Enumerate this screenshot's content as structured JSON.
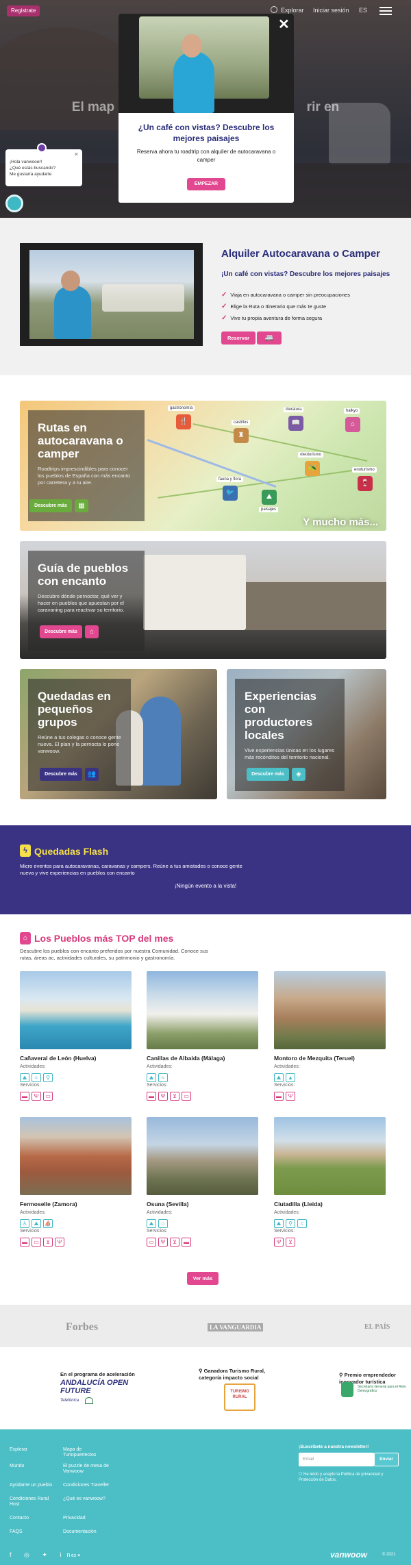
{
  "header": {
    "register": "Registrate",
    "explore": "Explorar",
    "login": "Iniciar sesión",
    "lang": "ES"
  },
  "hero": {
    "title_left": "El map",
    "title_right": "rir en"
  },
  "modal": {
    "title": "¿Un café con vistas? Descubre los mejores paisajes",
    "text": "Reserva ahora tu roadtrip con alquiler de autocaravana o camper",
    "button": "EMPEZAR",
    "close": "✕"
  },
  "chat": {
    "line1": "¡Hola vanwooer!",
    "line2": "¿Qué estás buscando?",
    "line3": "Me gustaría ayudarte"
  },
  "rent": {
    "title": "Alquiler Autocaravana o Camper",
    "subtitle": "¡Un café con vistas? Descubre los mejores paisajes",
    "items": [
      "Viaja en autocaravana o camper sin preocupaciones",
      "Elige la Ruta o Itinerario que más te guste",
      "Vive tu propia aventura de forma segura"
    ],
    "button": "Reservar"
  },
  "cards": {
    "routes": {
      "title": "Rutas en autocaravana o camper",
      "text": "Roadtrips imprescindibles para conocer los pueblos de España con más encanto por carretera y a tu aire.",
      "button": "Descubre más",
      "more": "Y mucho más...",
      "pins": [
        "gastronomía",
        "castillos",
        "literatura",
        "halkyo",
        "oleoturismo",
        "enoturismo",
        "fauna y flora",
        "paisajes"
      ]
    },
    "towns": {
      "title": "Guía de pueblos con encanto",
      "text": "Descubre dónde pernoctar, qué ver y hacer en pueblos que apuestan por el caravaning para reactivar su territorio.",
      "button": "Descubre más"
    },
    "groups": {
      "title": "Quedadas en pequeños grupos",
      "text": "Reúne a tus colegas o conoce gente nueva. El plan y la pernocta lo pone vanwoow.",
      "button": "Descubre más"
    },
    "experiences": {
      "title": "Experiencias con productores locales",
      "text": "Vive experiencias únicas en los lugares más recónditos del territorio nacional.",
      "button": "Descubre más"
    }
  },
  "flash": {
    "title": "Quedadas Flash",
    "text": "Micro eventos para autocaravanas, caravanas y campers. Reúne a tus amistades o conoce gente nueva y vive experiencias en pueblos con encanto",
    "empty": "¡Ningún evento a la vista!"
  },
  "top": {
    "title": "Los Pueblos más TOP del mes",
    "text": "Descubre los pueblos con encanto preferidos por nuestra Comunidad. Conoce sus rutas, áreas ac, actividades culturales, su patrimonio y gastronomía.",
    "activities_label": "Actividades:",
    "services_label": "Servicios:",
    "towns": [
      {
        "name": "Cañaveral de León (Huelva)",
        "acts": 3,
        "svcs": 3
      },
      {
        "name": "Canillas de Albaida (Málaga)",
        "acts": 2,
        "svcs": 4
      },
      {
        "name": "Montoro de Mezquita (Teruel)",
        "acts": 2,
        "svcs": 2
      },
      {
        "name": "Fermoselle (Zamora)",
        "acts": 3,
        "svcs": 4
      },
      {
        "name": "Osuna (Sevilla)",
        "acts": 2,
        "svcs": 4
      },
      {
        "name": "Ciutadilla (Lleida)",
        "acts": 3,
        "svcs": 2
      }
    ],
    "more_button": "Ver más"
  },
  "press": [
    "Forbes",
    "LA VANGUARDIA",
    "EL PAÍS"
  ],
  "awards": {
    "a1_title": "En el programa de aceleración",
    "a1_brand": "ANDALUCÍA OPEN FUTURE",
    "a2_title": "Ganadora Turismo Rural, categoría impacto social",
    "a2_seal": "TURISMO RURAL",
    "a3_title": "Premio emprendedor innovador turística"
  },
  "footer": {
    "col1": [
      "Explorar",
      "Mundo",
      "Ayúdame un pueblo",
      "Condiciones Rural Host",
      "Contacto",
      "FAQS"
    ],
    "col2": [
      "Mapa de Turiopuertectos",
      "El puzzle de mesa de Vanwoow",
      "Condiciones Traveller",
      "¿Qué es vanwoow?",
      "Privacidad",
      "Documentación"
    ],
    "newsletter": "¡Suscríbete a nuestra newsletter!",
    "email_placeholder": "Email",
    "send": "Enviar",
    "privacy": "He leído y acepto la Política de privacidad y Protección de Datos.",
    "social": "f ◎ ✦ in",
    "lang": "es ▾",
    "brand": "vanwoow",
    "copyright": "© 2021"
  },
  "colors": {
    "brand_pink": "#e2488f",
    "brand_navy": "#2b2e7a",
    "turquoise": "#4bbec6",
    "flash_bg": "#3a3384"
  }
}
